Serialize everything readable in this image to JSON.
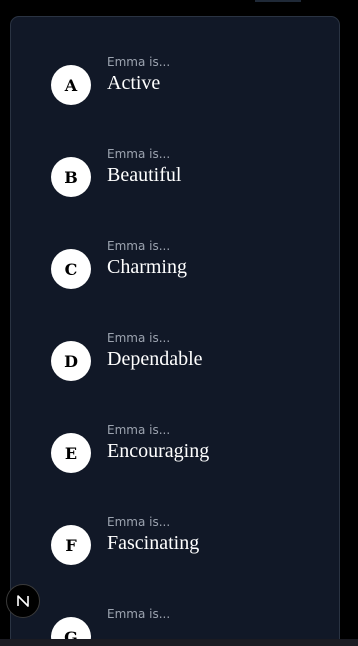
{
  "items": [
    {
      "letter": "A",
      "prefix": "Emma is...",
      "word": "Active"
    },
    {
      "letter": "B",
      "prefix": "Emma is...",
      "word": "Beautiful"
    },
    {
      "letter": "C",
      "prefix": "Emma is...",
      "word": "Charming"
    },
    {
      "letter": "D",
      "prefix": "Emma is...",
      "word": "Dependable"
    },
    {
      "letter": "E",
      "prefix": "Emma is...",
      "word": "Encouraging"
    },
    {
      "letter": "F",
      "prefix": "Emma is...",
      "word": "Fascinating"
    },
    {
      "letter": "G",
      "prefix": "Emma is...",
      "word": ""
    }
  ],
  "colors": {
    "background": "#000000",
    "card": "#111827",
    "badge": "#ffffff",
    "prefix_text": "#9ca3af",
    "word_text": "#ffffff"
  },
  "dev_indicator": {
    "icon": "nextjs-n-icon"
  }
}
